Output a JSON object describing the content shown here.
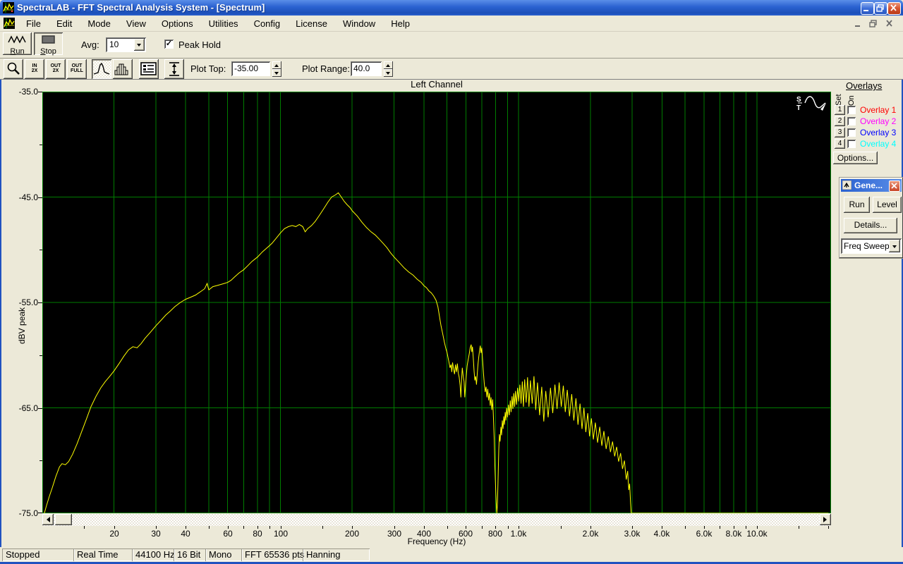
{
  "window": {
    "title": "SpectraLAB - FFT Spectral Analysis System - [Spectrum]"
  },
  "menu": {
    "items": [
      "File",
      "Edit",
      "Mode",
      "View",
      "Options",
      "Utilities",
      "Config",
      "License",
      "Window",
      "Help"
    ]
  },
  "toolbar": {
    "run_label": "Run",
    "stop_label": "Stop",
    "avg_label": "Avg:",
    "avg_value": "10",
    "peak_hold_label": "Peak Hold",
    "check_glyph": "✓",
    "plot_top_label": "Plot Top:",
    "plot_top_value": "-35.00",
    "plot_range_label": "Plot Range:",
    "plot_range_value": "40.0",
    "zoom_in_top": "IN",
    "zoom_in_bottom": "2X",
    "zoom_out_top": "OUT",
    "zoom_out_bottom": "2X",
    "zoom_full_top": "OUT",
    "zoom_full_bottom": "FULL"
  },
  "overlays": {
    "title": "Overlays",
    "set_label": "Set",
    "on_label": "On",
    "items": [
      {
        "num": "1",
        "label": "Overlay 1",
        "color": "#ff0000"
      },
      {
        "num": "2",
        "label": "Overlay 2",
        "color": "#ff00ff"
      },
      {
        "num": "3",
        "label": "Overlay 3",
        "color": "#0000ff"
      },
      {
        "num": "4",
        "label": "Overlay 4",
        "color": "#00ffff"
      }
    ],
    "options_label": "Options..."
  },
  "generator": {
    "title": "Gene...",
    "run_label": "Run",
    "level_label": "Level",
    "details_label": "Details...",
    "mode_value": "Freq Sweep"
  },
  "status_bar": {
    "cells": [
      "Stopped",
      "Real Time",
      "44100 Hz",
      "16 Bit",
      "Mono",
      "FFT 65536 pts",
      "Hanning"
    ]
  },
  "plot_icon_letters": {
    "top": "S",
    "bottom": "T"
  },
  "chart_data": {
    "type": "line",
    "title": "Left Channel",
    "xlabel": "Frequency (Hz)",
    "ylabel": "dBV peak",
    "x_scale": "log",
    "xlim": [
      10,
      20500
    ],
    "ylim": [
      -75,
      -35
    ],
    "bg_color": "#000000",
    "grid_color": "#007d00",
    "grid_on": true,
    "grid_freqs": [
      20,
      30,
      40,
      50,
      60,
      70,
      80,
      90,
      100,
      200,
      300,
      400,
      500,
      600,
      700,
      800,
      900,
      1000,
      2000,
      3000,
      4000,
      5000,
      6000,
      7000,
      8000,
      9000,
      10000
    ],
    "tick_freqs": [
      15,
      20,
      30,
      40,
      50,
      60,
      70,
      80,
      90,
      100,
      150,
      200,
      300,
      400,
      500,
      600,
      700,
      800,
      900,
      1000,
      1500,
      2000,
      3000,
      4000,
      5000,
      6000,
      7000,
      8000,
      9000,
      10000,
      15000,
      20000
    ],
    "x_tick_labels": [
      {
        "f": 20,
        "t": "20"
      },
      {
        "f": 30,
        "t": "30"
      },
      {
        "f": 40,
        "t": "40"
      },
      {
        "f": 60,
        "t": "60"
      },
      {
        "f": 80,
        "t": "80"
      },
      {
        "f": 100,
        "t": "100"
      },
      {
        "f": 200,
        "t": "200"
      },
      {
        "f": 300,
        "t": "300"
      },
      {
        "f": 400,
        "t": "400"
      },
      {
        "f": 600,
        "t": "600"
      },
      {
        "f": 800,
        "t": "800"
      },
      {
        "f": 1000,
        "t": "1.0k"
      },
      {
        "f": 2000,
        "t": "2.0k"
      },
      {
        "f": 3000,
        "t": "3.0k"
      },
      {
        "f": 4000,
        "t": "4.0k"
      },
      {
        "f": 6000,
        "t": "6.0k"
      },
      {
        "f": 8000,
        "t": "8.0k"
      },
      {
        "f": 10000,
        "t": "10.0k"
      }
    ],
    "y_tick_labels": [
      {
        "v": -35,
        "t": "-35.0"
      },
      {
        "v": -45,
        "t": "-45.0"
      },
      {
        "v": -55,
        "t": "-55.0"
      },
      {
        "v": -65,
        "t": "-65.0"
      },
      {
        "v": -75,
        "t": "-75.0"
      }
    ],
    "y_minor_ticks": [
      -40,
      -50,
      -60,
      -70
    ],
    "y_grid_values": [
      -45,
      -55,
      -65
    ],
    "series": [
      {
        "name": "left-channel-peak-hold",
        "color": "#ffff00",
        "points": [
          [
            10.2,
            -75
          ],
          [
            10.4,
            -74.3
          ],
          [
            10.7,
            -73.4
          ],
          [
            11,
            -72.6
          ],
          [
            11.4,
            -71.5
          ],
          [
            11.8,
            -70.6
          ],
          [
            12.1,
            -70.3
          ],
          [
            12.5,
            -70.4
          ],
          [
            12.9,
            -70.1
          ],
          [
            13.4,
            -69.4
          ],
          [
            14,
            -68.4
          ],
          [
            14.6,
            -67.3
          ],
          [
            15.3,
            -66.1
          ],
          [
            16,
            -64.9
          ],
          [
            16.8,
            -63.9
          ],
          [
            17.6,
            -63.1
          ],
          [
            18.4,
            -62.5
          ],
          [
            19.2,
            -62
          ],
          [
            20,
            -61.5
          ],
          [
            21,
            -60.8
          ],
          [
            22,
            -60.1
          ],
          [
            23,
            -59.5
          ],
          [
            24,
            -59.2
          ],
          [
            25,
            -59.3
          ],
          [
            26,
            -58.9
          ],
          [
            27,
            -58.4
          ],
          [
            28.5,
            -57.8
          ],
          [
            30,
            -57.2
          ],
          [
            31.5,
            -56.7
          ],
          [
            33,
            -56.2
          ],
          [
            34.5,
            -55.8
          ],
          [
            36,
            -55.4
          ],
          [
            38,
            -55
          ],
          [
            40,
            -54.7
          ],
          [
            42,
            -54.5
          ],
          [
            44,
            -54.3
          ],
          [
            46,
            -54
          ],
          [
            48,
            -53.7
          ],
          [
            49.2,
            -53.2
          ],
          [
            50,
            -53.8
          ],
          [
            52,
            -53.5
          ],
          [
            54,
            -53.4
          ],
          [
            56,
            -53.3
          ],
          [
            58,
            -53.2
          ],
          [
            60,
            -53.1
          ],
          [
            62,
            -52.9
          ],
          [
            64,
            -52.6
          ],
          [
            67,
            -52.2
          ],
          [
            70,
            -51.9
          ],
          [
            73,
            -51.5
          ],
          [
            76,
            -51.1
          ],
          [
            80,
            -50.7
          ],
          [
            84,
            -50.2
          ],
          [
            88,
            -49.8
          ],
          [
            92,
            -49.4
          ],
          [
            96,
            -48.9
          ],
          [
            100,
            -48.4
          ],
          [
            104,
            -48
          ],
          [
            108,
            -47.8
          ],
          [
            112,
            -47.7
          ],
          [
            116,
            -47.8
          ],
          [
            120,
            -47.6
          ],
          [
            124,
            -47.8
          ],
          [
            127,
            -48.3
          ],
          [
            130,
            -48
          ],
          [
            135,
            -47.7
          ],
          [
            140,
            -47.3
          ],
          [
            146,
            -46.7
          ],
          [
            152,
            -46.1
          ],
          [
            158,
            -45.5
          ],
          [
            164,
            -45
          ],
          [
            170,
            -44.8
          ],
          [
            175,
            -44.6
          ],
          [
            180,
            -45
          ],
          [
            185,
            -45.4
          ],
          [
            190,
            -45.7
          ],
          [
            196,
            -46
          ],
          [
            200,
            -46.3
          ],
          [
            210,
            -46.8
          ],
          [
            220,
            -47.4
          ],
          [
            230,
            -47.9
          ],
          [
            240,
            -48.3
          ],
          [
            250,
            -48.6
          ],
          [
            260,
            -49
          ],
          [
            270,
            -49.4
          ],
          [
            280,
            -49.8
          ],
          [
            290,
            -50.3
          ],
          [
            300,
            -50.7
          ],
          [
            315,
            -51.2
          ],
          [
            330,
            -51.7
          ],
          [
            345,
            -52.1
          ],
          [
            360,
            -52.4
          ],
          [
            375,
            -52.8
          ],
          [
            390,
            -53.1
          ],
          [
            400,
            -53.4
          ],
          [
            410,
            -53.6
          ],
          [
            420,
            -53.9
          ],
          [
            430,
            -54.1
          ],
          [
            440,
            -54.4
          ],
          [
            450,
            -54.8
          ],
          [
            458,
            -55.4
          ],
          [
            465,
            -56.3
          ],
          [
            472,
            -57.2
          ],
          [
            480,
            -58
          ],
          [
            488,
            -58.8
          ],
          [
            495,
            -59.4
          ],
          [
            500,
            -59.7
          ],
          [
            505,
            -60.2
          ],
          [
            510,
            -60.7
          ],
          [
            515,
            -61.2
          ],
          [
            520,
            -60.9
          ],
          [
            524,
            -61.6
          ],
          [
            528,
            -60.7
          ],
          [
            533,
            -61.3
          ],
          [
            538,
            -61.8
          ],
          [
            543,
            -60.9
          ],
          [
            548,
            -61.6
          ],
          [
            553,
            -60.8
          ],
          [
            558,
            -61.7
          ],
          [
            563,
            -62.1
          ],
          [
            568,
            -62.9
          ],
          [
            572,
            -64
          ],
          [
            576,
            -62.3
          ],
          [
            580,
            -61.2
          ],
          [
            585,
            -62
          ],
          [
            590,
            -62.5
          ],
          [
            594,
            -64
          ],
          [
            598,
            -63
          ],
          [
            603,
            -61.9
          ],
          [
            608,
            -61
          ],
          [
            614,
            -60.4
          ],
          [
            620,
            -59.9
          ],
          [
            626,
            -59.3
          ],
          [
            632,
            -59
          ],
          [
            636,
            -59.7
          ],
          [
            640,
            -59.2
          ],
          [
            645,
            -60.3
          ],
          [
            650,
            -61.5
          ],
          [
            655,
            -62.4
          ],
          [
            660,
            -62
          ],
          [
            665,
            -62.8
          ],
          [
            670,
            -61.8
          ],
          [
            675,
            -60.9
          ],
          [
            680,
            -60.2
          ],
          [
            685,
            -59.6
          ],
          [
            690,
            -59.1
          ],
          [
            695,
            -59.8
          ],
          [
            700,
            -59.3
          ],
          [
            706,
            -60.5
          ],
          [
            712,
            -61.8
          ],
          [
            718,
            -62.8
          ],
          [
            724,
            -63.5
          ],
          [
            730,
            -63
          ],
          [
            736,
            -64
          ],
          [
            742,
            -63.2
          ],
          [
            748,
            -64.3
          ],
          [
            754,
            -63.6
          ],
          [
            760,
            -64.8
          ],
          [
            766,
            -64
          ],
          [
            772,
            -65.2
          ],
          [
            778,
            -64.2
          ],
          [
            784,
            -66
          ],
          [
            790,
            -68
          ],
          [
            795,
            -70.5
          ],
          [
            800,
            -72.5
          ],
          [
            805,
            -74
          ],
          [
            810,
            -75
          ],
          [
            815,
            -74
          ],
          [
            820,
            -71.5
          ],
          [
            825,
            -69
          ],
          [
            830,
            -67.5
          ],
          [
            836,
            -68.2
          ],
          [
            842,
            -66.8
          ],
          [
            848,
            -67.6
          ],
          [
            854,
            -66.2
          ],
          [
            860,
            -67
          ],
          [
            866,
            -65.8
          ],
          [
            872,
            -66.6
          ],
          [
            878,
            -65.4
          ],
          [
            884,
            -66.2
          ],
          [
            890,
            -65
          ],
          [
            898,
            -65.9
          ],
          [
            906,
            -64.7
          ],
          [
            914,
            -65.7
          ],
          [
            922,
            -64.3
          ],
          [
            930,
            -65.4
          ],
          [
            938,
            -63.9
          ],
          [
            946,
            -65.1
          ],
          [
            954,
            -63.6
          ],
          [
            962,
            -64.9
          ],
          [
            970,
            -63.4
          ],
          [
            980,
            -64.7
          ],
          [
            990,
            -63.1
          ],
          [
            1000,
            -64.4
          ],
          [
            1012,
            -62.8
          ],
          [
            1024,
            -64.6
          ],
          [
            1036,
            -62.5
          ],
          [
            1048,
            -64.9
          ],
          [
            1060,
            -62.3
          ],
          [
            1075,
            -64.5
          ],
          [
            1090,
            -62.1
          ],
          [
            1105,
            -64.9
          ],
          [
            1120,
            -62.4
          ],
          [
            1140,
            -64.6
          ],
          [
            1160,
            -62
          ],
          [
            1180,
            -65.2
          ],
          [
            1200,
            -62.6
          ],
          [
            1225,
            -65.7
          ],
          [
            1250,
            -63
          ],
          [
            1275,
            -66.3
          ],
          [
            1300,
            -63.4
          ],
          [
            1330,
            -65.9
          ],
          [
            1360,
            -63.1
          ],
          [
            1390,
            -65.5
          ],
          [
            1420,
            -62.8
          ],
          [
            1450,
            -65.1
          ],
          [
            1480,
            -62.6
          ],
          [
            1510,
            -64.9
          ],
          [
            1540,
            -62.9
          ],
          [
            1570,
            -65.4
          ],
          [
            1600,
            -63.3
          ],
          [
            1635,
            -65.8
          ],
          [
            1670,
            -63.7
          ],
          [
            1705,
            -66.2
          ],
          [
            1740,
            -64.1
          ],
          [
            1775,
            -66.6
          ],
          [
            1810,
            -64.6
          ],
          [
            1845,
            -67
          ],
          [
            1880,
            -65
          ],
          [
            1915,
            -67.3
          ],
          [
            1950,
            -65.5
          ],
          [
            1985,
            -67.7
          ],
          [
            2020,
            -66
          ],
          [
            2060,
            -68
          ],
          [
            2100,
            -66.4
          ],
          [
            2145,
            -68.3
          ],
          [
            2190,
            -66.8
          ],
          [
            2235,
            -68.6
          ],
          [
            2280,
            -67.2
          ],
          [
            2330,
            -68.9
          ],
          [
            2380,
            -67.7
          ],
          [
            2430,
            -69.2
          ],
          [
            2480,
            -68.2
          ],
          [
            2530,
            -69.6
          ],
          [
            2580,
            -68.7
          ],
          [
            2630,
            -70.1
          ],
          [
            2680,
            -69.3
          ],
          [
            2730,
            -70.8
          ],
          [
            2780,
            -70
          ],
          [
            2830,
            -71.8
          ],
          [
            2870,
            -71
          ],
          [
            2900,
            -72.8
          ],
          [
            2925,
            -72.2
          ],
          [
            2950,
            -74
          ],
          [
            2970,
            -75
          ],
          [
            20000,
            -75
          ]
        ]
      }
    ]
  }
}
